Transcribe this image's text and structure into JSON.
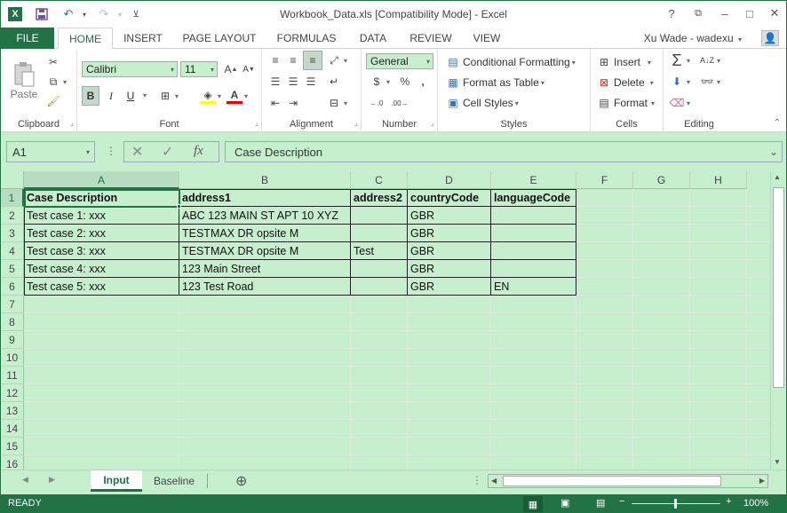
{
  "window": {
    "title": "Workbook_Data.xls  [Compatibility Mode] - Excel",
    "help": "?",
    "minimize": "–",
    "maximize": "□",
    "close": "✕"
  },
  "quick_access": {
    "app_icon_letter": "X"
  },
  "tabs": {
    "file": "FILE",
    "items": [
      "HOME",
      "INSERT",
      "PAGE LAYOUT",
      "FORMULAS",
      "DATA",
      "REVIEW",
      "VIEW"
    ],
    "active": "HOME"
  },
  "user": {
    "name": "Xu Wade - wadexu"
  },
  "ribbon": {
    "clipboard": {
      "label": "Clipboard",
      "paste": "Paste"
    },
    "font": {
      "label": "Font",
      "name": "Calibri",
      "size": "11",
      "bold": "B",
      "italic": "I",
      "underline": "U"
    },
    "alignment": {
      "label": "Alignment"
    },
    "number": {
      "label": "Number",
      "format": "General",
      "currency": "$",
      "percent": "%"
    },
    "styles": {
      "label": "Styles",
      "conditional": "Conditional Formatting",
      "format_table": "Format as Table",
      "cell_styles": "Cell Styles"
    },
    "cells": {
      "label": "Cells",
      "insert": "Insert",
      "delete": "Delete",
      "format": "Format"
    },
    "editing": {
      "label": "Editing"
    }
  },
  "formula_bar": {
    "name_box": "A1",
    "fx": "fx",
    "content": "Case Description"
  },
  "grid": {
    "columns": [
      "A",
      "B",
      "C",
      "D",
      "E",
      "F",
      "G",
      "H"
    ],
    "rows": [
      "1",
      "2",
      "3",
      "4",
      "5",
      "6",
      "7",
      "8",
      "9",
      "10",
      "11",
      "12",
      "13",
      "14",
      "15",
      "16"
    ],
    "headers": [
      "Case Description",
      "address1",
      "address2",
      "countryCode",
      "languageCode"
    ],
    "data": [
      [
        "Test case 1: xxx",
        "ABC 123 MAIN ST APT 10 XYZ",
        "",
        "GBR",
        ""
      ],
      [
        "Test case 2: xxx",
        "TESTMAX DR opsite M",
        "",
        "GBR",
        ""
      ],
      [
        "Test case 3: xxx",
        "TESTMAX DR opsite M",
        "Test",
        "GBR",
        ""
      ],
      [
        "Test case 4: xxx",
        "123 Main Street",
        "",
        "GBR",
        ""
      ],
      [
        "Test case 5: xxx",
        "123 Test Road",
        "",
        "GBR",
        "EN"
      ]
    ]
  },
  "sheets": {
    "tabs": [
      "Input",
      "Baseline"
    ],
    "active": "Input"
  },
  "status": {
    "text": "READY",
    "zoom": "100%"
  },
  "colors": {
    "accent": "#217346",
    "cell_fill": "#c6efce"
  }
}
